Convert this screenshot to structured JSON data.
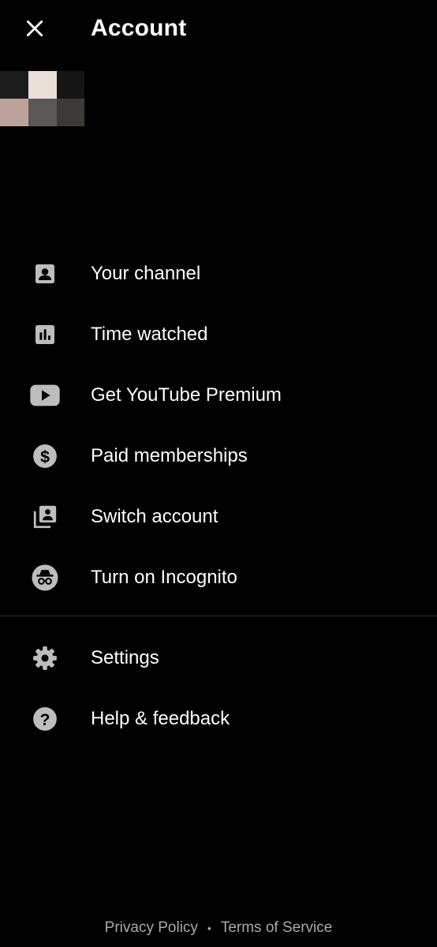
{
  "header": {
    "title": "Account",
    "close_icon": "close-icon"
  },
  "colors": {
    "background": "#000000",
    "text": "#ffffff",
    "icon": "#bdbdbd",
    "footer_text": "#aaaaaa",
    "divider": "#2b2b2b"
  },
  "account": {
    "avatar_colors": [
      "#1c1c1c",
      "#e9ded8",
      "#151515",
      "#bda39c",
      "#5a5757",
      "#3b3a37"
    ]
  },
  "menu": {
    "items": [
      {
        "label": "Your channel",
        "icon": "account-box-icon"
      },
      {
        "label": "Time watched",
        "icon": "bar-chart-icon"
      },
      {
        "label": "Get YouTube Premium",
        "icon": "youtube-play-icon"
      },
      {
        "label": "Paid memberships",
        "icon": "dollar-circle-icon"
      },
      {
        "label": "Switch account",
        "icon": "switch-account-icon"
      },
      {
        "label": "Turn on Incognito",
        "icon": "incognito-icon"
      }
    ],
    "secondary": [
      {
        "label": "Settings",
        "icon": "gear-icon"
      },
      {
        "label": "Help & feedback",
        "icon": "help-icon"
      }
    ]
  },
  "footer": {
    "privacy": "Privacy Policy",
    "separator": "•",
    "terms": "Terms of Service"
  }
}
